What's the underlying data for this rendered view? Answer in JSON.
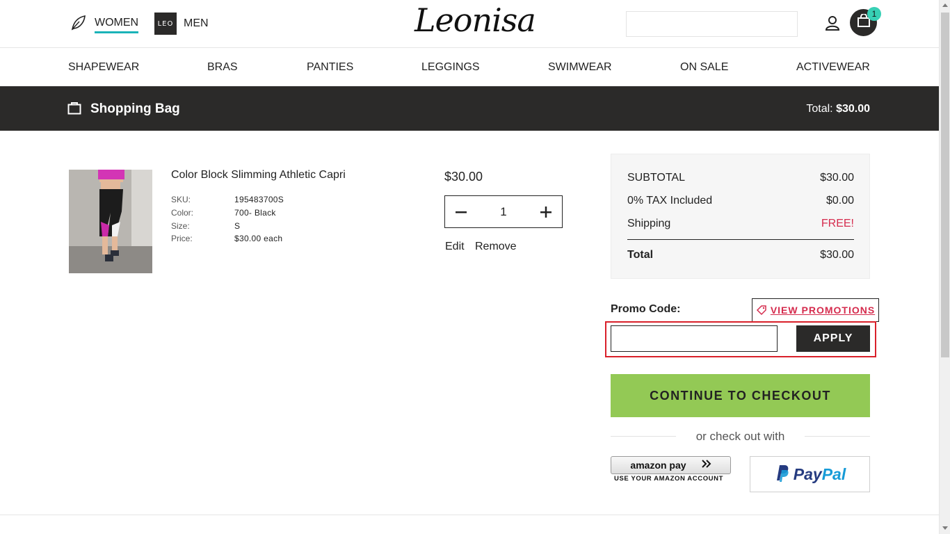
{
  "header": {
    "women_label": "WOMEN",
    "men_label": "MEN",
    "leo_badge": "LEO",
    "logo_text": "Leonisa",
    "search_value": "",
    "cart_count": "1"
  },
  "categories": [
    "SHAPEWEAR",
    "BRAS",
    "PANTIES",
    "LEGGINGS",
    "SWIMWEAR",
    "ON SALE",
    "ACTIVEWEAR"
  ],
  "bag": {
    "title": "Shopping Bag",
    "total_label": "Total:",
    "total_value": "$30.00"
  },
  "item": {
    "name": "Color Block Slimming Athletic Capri",
    "specs": [
      {
        "label": "SKU:",
        "value": "195483700S"
      },
      {
        "label": "Color:",
        "value": "700- Black"
      },
      {
        "label": "Size:",
        "value": "S"
      },
      {
        "label": "Price:",
        "value": "$30.00 each"
      }
    ],
    "price": "$30.00",
    "quantity": "1",
    "edit_label": "Edit",
    "remove_label": "Remove"
  },
  "summary": {
    "subtotal_label": "SUBTOTAL",
    "subtotal_value": "$30.00",
    "tax_label": "0% TAX Included",
    "tax_value": "$0.00",
    "shipping_label": "Shipping",
    "shipping_value": "FREE!",
    "total_label": "Total",
    "total_value": "$30.00"
  },
  "promo": {
    "label": "Promo Code:",
    "view_label": "VIEW PROMOTIONS",
    "input_value": "",
    "apply_label": "APPLY"
  },
  "checkout": {
    "button_label": "CONTINUE TO CHECKOUT",
    "or_text": "or check out with",
    "amazon_label": "amazon pay",
    "amazon_sub": "USE YOUR AMAZON ACCOUNT",
    "paypal_a": "Pay",
    "paypal_b": "Pal"
  },
  "colors": {
    "accent_teal": "#1ab3b8",
    "dark": "#2b2a29",
    "checkout_green": "#93c955",
    "sale_red": "#d52b4d",
    "highlight_red": "#d9202a"
  }
}
